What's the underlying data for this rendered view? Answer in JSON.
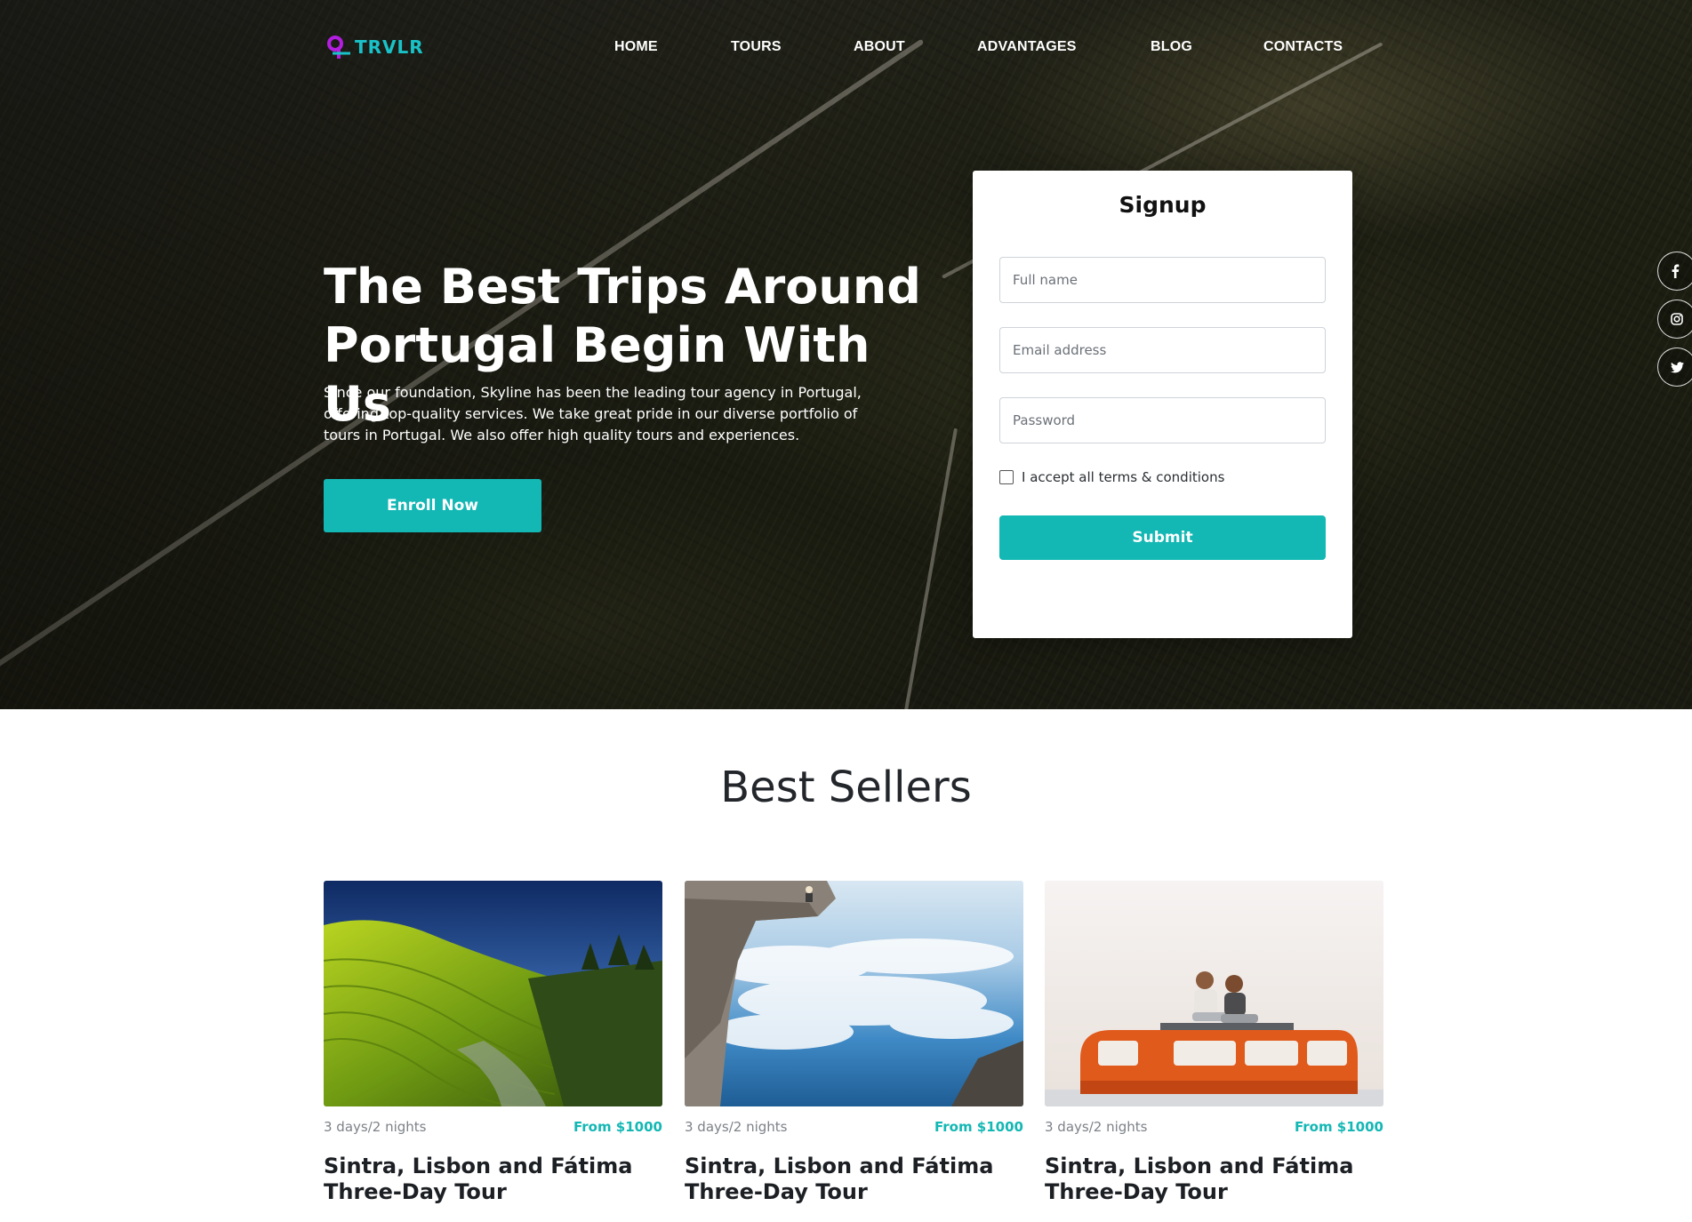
{
  "brand": {
    "logo_text": "TRVLR",
    "logo_tagline": "",
    "accent_color": "#13b7b4",
    "logo_mark_color": "#b31ee0"
  },
  "nav": {
    "items": [
      {
        "label": "HOME"
      },
      {
        "label": "TOURS"
      },
      {
        "label": "ABOUT"
      },
      {
        "label": "ADVANTAGES"
      },
      {
        "label": "BLOG"
      },
      {
        "label": "CONTACTS"
      }
    ]
  },
  "hero": {
    "title": "The Best Trips Around Portugal Begin With Us",
    "description": "Since our foundation, Skyline has been the leading tour agency in Portugal, offering top-quality services. We take great pride in our diverse portfolio of tours in Portugal. We also offer high quality tours and experiences.",
    "cta_label": "Enroll Now"
  },
  "signup": {
    "title": "Signup",
    "full_name_placeholder": "Full name",
    "email_placeholder": "Email address",
    "password_placeholder": "Password",
    "terms_label": "I accept all terms & conditions",
    "terms_checked": false,
    "submit_label": "Submit"
  },
  "social": {
    "items": [
      {
        "icon": "facebook-icon"
      },
      {
        "icon": "instagram-icon"
      },
      {
        "icon": "twitter-icon"
      }
    ]
  },
  "best_sellers": {
    "title": "Best Sellers",
    "cards": [
      {
        "image": "rice-terraces-photo",
        "duration": "3 days/2 nights",
        "price": "From $1000",
        "title": "Sintra, Lisbon and Fátima Three-Day Tour"
      },
      {
        "image": "cliff-above-clouds-photo",
        "duration": "3 days/2 nights",
        "price": "From $1000",
        "title": "Sintra, Lisbon and Fátima Three-Day Tour"
      },
      {
        "image": "friends-on-orange-van-photo",
        "duration": "3 days/2 nights",
        "price": "From $1000",
        "title": "Sintra, Lisbon and Fátima Three-Day Tour"
      }
    ]
  }
}
